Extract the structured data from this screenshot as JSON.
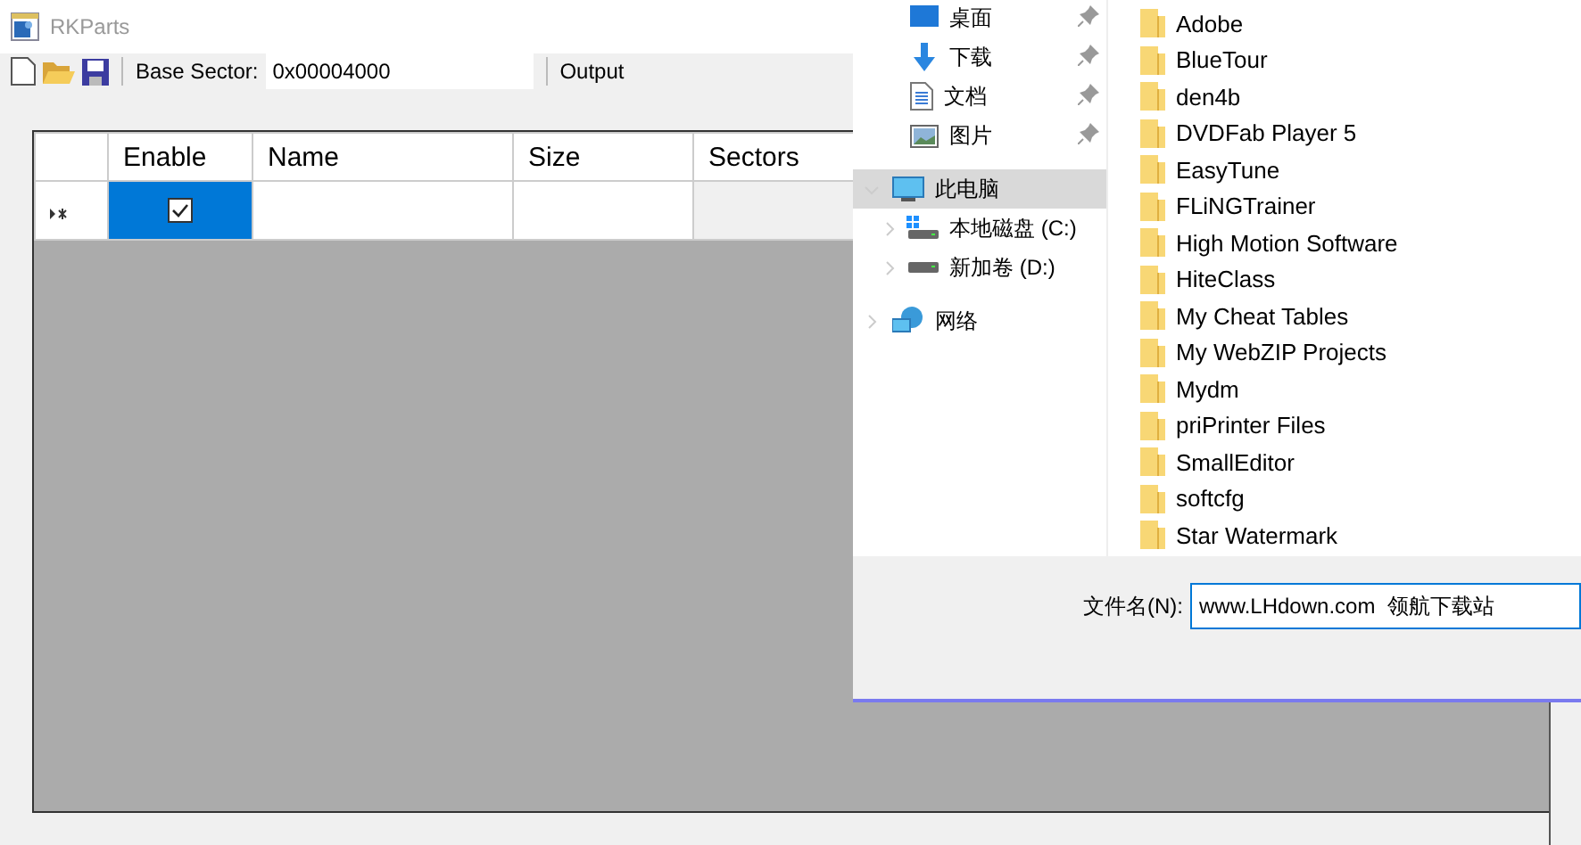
{
  "main_window": {
    "title": "RKParts",
    "toolbar": {
      "base_sector_label": "Base Sector:",
      "base_sector_value": "0x00004000",
      "output_label": "Output"
    },
    "grid": {
      "columns": [
        "Enable",
        "Name",
        "Size",
        "Sectors"
      ],
      "rows": [
        {
          "enable_checked": true,
          "enable_selected": true
        }
      ]
    }
  },
  "file_dialog": {
    "nav": [
      {
        "label": "桌面",
        "kind": "desktop",
        "pinned": true
      },
      {
        "label": "下载",
        "kind": "download",
        "pinned": true
      },
      {
        "label": "文档",
        "kind": "document",
        "pinned": true
      },
      {
        "label": "图片",
        "kind": "pictures",
        "pinned": true
      },
      {
        "label": "此电脑",
        "kind": "pc",
        "expanded": true,
        "selected": true,
        "children": [
          {
            "label": "本地磁盘 (C:)",
            "kind": "system-drive",
            "expanded": false,
            "selected": false
          },
          {
            "label": "新加卷 (D:)",
            "kind": "drive",
            "expanded": false,
            "selected": false
          }
        ]
      },
      {
        "label": "网络",
        "kind": "network",
        "expanded": false,
        "selected": false
      }
    ],
    "folders": [
      "Adobe",
      "BlueTour",
      "den4b",
      "DVDFab Player 5",
      "EasyTune",
      "FLiNGTrainer",
      "High Motion Software",
      "HiteClass",
      "My Cheat Tables",
      "My WebZIP Projects",
      "Mydm",
      "priPrinter Files",
      "SmallEditor",
      "softcfg",
      "Star Watermark"
    ],
    "file_name_label": "文件名(N):",
    "file_name_value": "www.LHdown.com  领航下载站"
  }
}
